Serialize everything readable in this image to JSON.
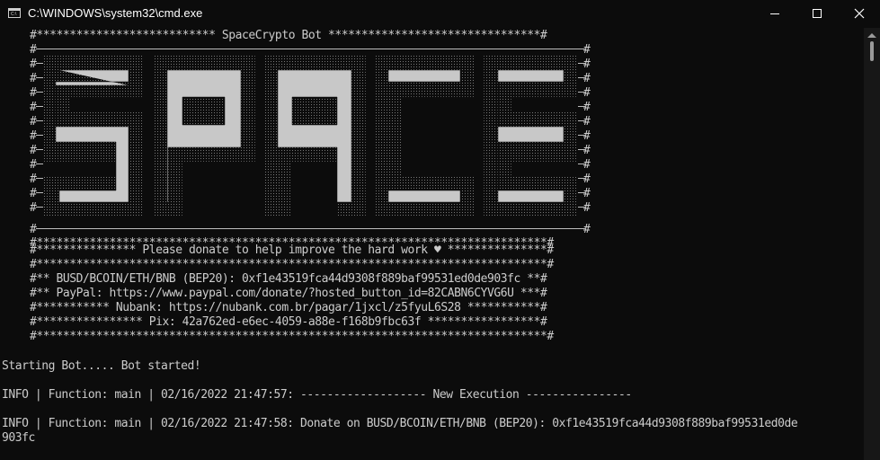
{
  "window": {
    "title": "C:\\WINDOWS\\system32\\cmd.exe",
    "app_icon_label": "C:\\",
    "app_icon": "console-icon",
    "controls": [
      "minimize-icon",
      "maximize-icon",
      "close-icon"
    ]
  },
  "banner": {
    "title_line": "#*************************** SpaceCrypto Bot ********************************#",
    "art_word": "SPACE",
    "edge_line_left": "#",
    "edge_line_right": "#",
    "star_line": "#*****************************************************************************#",
    "donate_line": "#*************** Please donate to help improve the hard work ♥ ***************#",
    "wallet_line": "#** BUSD/BCOIN/ETH/BNB (BEP20): 0xf1e43519fca44d9308f889baf99531ed0de903fc **#",
    "paypal_line": "#** PayPal: https://www.paypal.com/donate/?hosted_button_id=82CABN6CYVG6U ***#",
    "nubank_line": "#*********** Nubank: https://nubank.com.br/pagar/1jxcl/z5fyuL6S28 ***********#",
    "pix_line": "#**************** Pix: 42a762ed-e6ec-4059-a88e-f168b9fbc63f *****************#"
  },
  "log": {
    "starting": "Starting Bot..... Bot started!",
    "entry1": "INFO | Function: main | 02/16/2022 21:47:57: ------------------- New Execution ----------------",
    "entry2_line1": "INFO | Function: main | 02/16/2022 21:47:58: Donate on BUSD/BCOIN/ETH/BNB (BEP20): 0xf1e43519fca44d9308f889baf99531ed0de",
    "entry2_line2": "903fc"
  },
  "colors": {
    "background": "#0c0c0c",
    "text": "#cccccc",
    "art_fill": "#c8c8c8"
  },
  "scrollbar": {
    "up_arrow": "scroll-up-arrow-icon"
  }
}
